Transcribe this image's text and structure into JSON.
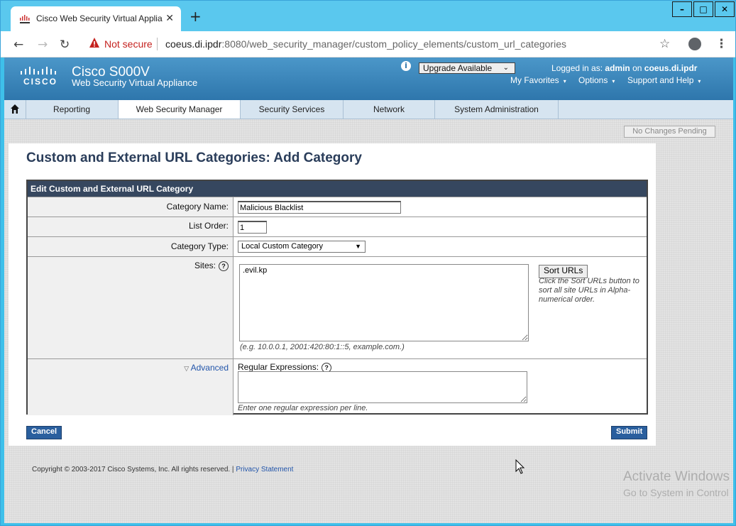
{
  "browser": {
    "tab_title": "Cisco Web Security Virtual Applia",
    "new_tab": "+",
    "not_secure": "Not secure",
    "url_host": "coeus.di.ipdr",
    "url_rest": ":8080/web_security_manager/custom_policy_elements/custom_url_categories"
  },
  "header": {
    "product": "Cisco S000V",
    "product_sub": "Web Security Virtual Appliance",
    "upgrade": "Upgrade Available",
    "logged_prefix": "Logged in as:",
    "user": "admin",
    "on": "on",
    "host": "coeus.di.ipdr",
    "links": [
      "My Favorites",
      "Options",
      "Support and Help"
    ]
  },
  "nav": {
    "tabs": [
      "Reporting",
      "Web Security Manager",
      "Security Services",
      "Network",
      "System Administration"
    ],
    "active": "Web Security Manager"
  },
  "pending": "No Changes Pending",
  "page": {
    "title": "Custom and External URL Categories: Add Category",
    "section": "Edit Custom and External URL Category",
    "fields": {
      "name_label": "Category Name:",
      "name_value": "Malicious Blacklist",
      "order_label": "List Order:",
      "order_value": "1",
      "type_label": "Category Type:",
      "type_value": "Local Custom Category",
      "sites_label": "Sites:",
      "sites_value": ".evil.kp",
      "sites_hint": "(e.g. 10.0.0.1, 2001:420:80:1::5, example.com.)",
      "sort_button": "Sort URLs",
      "sort_help": "Click the Sort URLs button to sort all site URLs in Alpha-numerical order.",
      "advanced": "Advanced",
      "regex_label": "Regular Expressions:",
      "regex_hint": "Enter one regular expression per line."
    },
    "cancel": "Cancel",
    "submit": "Submit"
  },
  "footer": {
    "copyright": "Copyright © 2003-2017 Cisco Systems, Inc. All rights reserved. |",
    "privacy": "Privacy Statement"
  },
  "watermark": {
    "line1": "Activate Windows",
    "line2": "Go to System in Control"
  }
}
